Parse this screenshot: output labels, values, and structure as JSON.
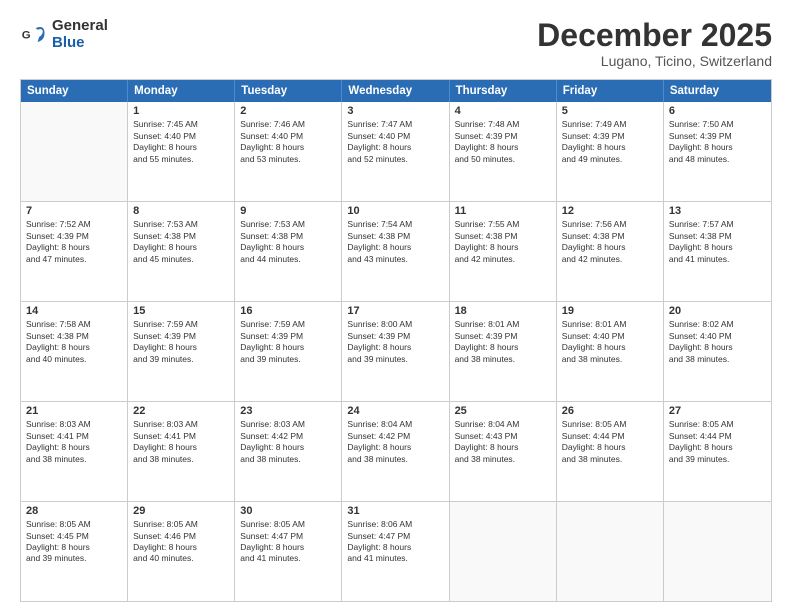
{
  "logo": {
    "general": "General",
    "blue": "Blue"
  },
  "title": {
    "month": "December 2025",
    "location": "Lugano, Ticino, Switzerland"
  },
  "headers": [
    "Sunday",
    "Monday",
    "Tuesday",
    "Wednesday",
    "Thursday",
    "Friday",
    "Saturday"
  ],
  "rows": [
    [
      {
        "day": "",
        "text": ""
      },
      {
        "day": "1",
        "text": "Sunrise: 7:45 AM\nSunset: 4:40 PM\nDaylight: 8 hours\nand 55 minutes."
      },
      {
        "day": "2",
        "text": "Sunrise: 7:46 AM\nSunset: 4:40 PM\nDaylight: 8 hours\nand 53 minutes."
      },
      {
        "day": "3",
        "text": "Sunrise: 7:47 AM\nSunset: 4:40 PM\nDaylight: 8 hours\nand 52 minutes."
      },
      {
        "day": "4",
        "text": "Sunrise: 7:48 AM\nSunset: 4:39 PM\nDaylight: 8 hours\nand 50 minutes."
      },
      {
        "day": "5",
        "text": "Sunrise: 7:49 AM\nSunset: 4:39 PM\nDaylight: 8 hours\nand 49 minutes."
      },
      {
        "day": "6",
        "text": "Sunrise: 7:50 AM\nSunset: 4:39 PM\nDaylight: 8 hours\nand 48 minutes."
      }
    ],
    [
      {
        "day": "7",
        "text": "Sunrise: 7:52 AM\nSunset: 4:39 PM\nDaylight: 8 hours\nand 47 minutes."
      },
      {
        "day": "8",
        "text": "Sunrise: 7:53 AM\nSunset: 4:38 PM\nDaylight: 8 hours\nand 45 minutes."
      },
      {
        "day": "9",
        "text": "Sunrise: 7:53 AM\nSunset: 4:38 PM\nDaylight: 8 hours\nand 44 minutes."
      },
      {
        "day": "10",
        "text": "Sunrise: 7:54 AM\nSunset: 4:38 PM\nDaylight: 8 hours\nand 43 minutes."
      },
      {
        "day": "11",
        "text": "Sunrise: 7:55 AM\nSunset: 4:38 PM\nDaylight: 8 hours\nand 42 minutes."
      },
      {
        "day": "12",
        "text": "Sunrise: 7:56 AM\nSunset: 4:38 PM\nDaylight: 8 hours\nand 42 minutes."
      },
      {
        "day": "13",
        "text": "Sunrise: 7:57 AM\nSunset: 4:38 PM\nDaylight: 8 hours\nand 41 minutes."
      }
    ],
    [
      {
        "day": "14",
        "text": "Sunrise: 7:58 AM\nSunset: 4:38 PM\nDaylight: 8 hours\nand 40 minutes."
      },
      {
        "day": "15",
        "text": "Sunrise: 7:59 AM\nSunset: 4:39 PM\nDaylight: 8 hours\nand 39 minutes."
      },
      {
        "day": "16",
        "text": "Sunrise: 7:59 AM\nSunset: 4:39 PM\nDaylight: 8 hours\nand 39 minutes."
      },
      {
        "day": "17",
        "text": "Sunrise: 8:00 AM\nSunset: 4:39 PM\nDaylight: 8 hours\nand 39 minutes."
      },
      {
        "day": "18",
        "text": "Sunrise: 8:01 AM\nSunset: 4:39 PM\nDaylight: 8 hours\nand 38 minutes."
      },
      {
        "day": "19",
        "text": "Sunrise: 8:01 AM\nSunset: 4:40 PM\nDaylight: 8 hours\nand 38 minutes."
      },
      {
        "day": "20",
        "text": "Sunrise: 8:02 AM\nSunset: 4:40 PM\nDaylight: 8 hours\nand 38 minutes."
      }
    ],
    [
      {
        "day": "21",
        "text": "Sunrise: 8:03 AM\nSunset: 4:41 PM\nDaylight: 8 hours\nand 38 minutes."
      },
      {
        "day": "22",
        "text": "Sunrise: 8:03 AM\nSunset: 4:41 PM\nDaylight: 8 hours\nand 38 minutes."
      },
      {
        "day": "23",
        "text": "Sunrise: 8:03 AM\nSunset: 4:42 PM\nDaylight: 8 hours\nand 38 minutes."
      },
      {
        "day": "24",
        "text": "Sunrise: 8:04 AM\nSunset: 4:42 PM\nDaylight: 8 hours\nand 38 minutes."
      },
      {
        "day": "25",
        "text": "Sunrise: 8:04 AM\nSunset: 4:43 PM\nDaylight: 8 hours\nand 38 minutes."
      },
      {
        "day": "26",
        "text": "Sunrise: 8:05 AM\nSunset: 4:44 PM\nDaylight: 8 hours\nand 38 minutes."
      },
      {
        "day": "27",
        "text": "Sunrise: 8:05 AM\nSunset: 4:44 PM\nDaylight: 8 hours\nand 39 minutes."
      }
    ],
    [
      {
        "day": "28",
        "text": "Sunrise: 8:05 AM\nSunset: 4:45 PM\nDaylight: 8 hours\nand 39 minutes."
      },
      {
        "day": "29",
        "text": "Sunrise: 8:05 AM\nSunset: 4:46 PM\nDaylight: 8 hours\nand 40 minutes."
      },
      {
        "day": "30",
        "text": "Sunrise: 8:05 AM\nSunset: 4:47 PM\nDaylight: 8 hours\nand 41 minutes."
      },
      {
        "day": "31",
        "text": "Sunrise: 8:06 AM\nSunset: 4:47 PM\nDaylight: 8 hours\nand 41 minutes."
      },
      {
        "day": "",
        "text": ""
      },
      {
        "day": "",
        "text": ""
      },
      {
        "day": "",
        "text": ""
      }
    ]
  ]
}
